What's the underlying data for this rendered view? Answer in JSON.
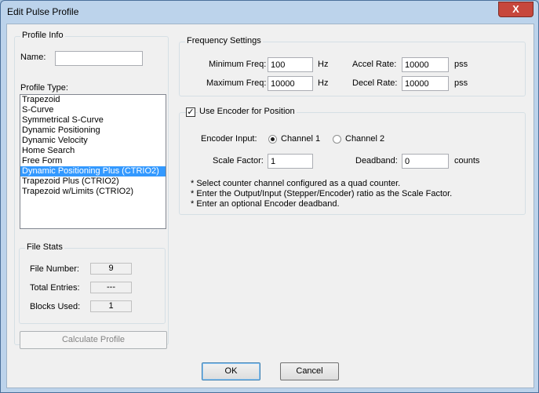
{
  "window": {
    "title": "Edit Pulse Profile",
    "close_glyph": "X"
  },
  "profile_info": {
    "legend": "Profile Info",
    "name_label": "Name:",
    "name_value": "",
    "type_label": "Profile Type:",
    "types": [
      "Trapezoid",
      "S-Curve",
      "Symmetrical S-Curve",
      "Dynamic Positioning",
      "Dynamic Velocity",
      "Home Search",
      "Free Form",
      "Dynamic Positioning Plus (CTRIO2)",
      "Trapezoid Plus (CTRIO2)",
      "Trapezoid w/Limits (CTRIO2)"
    ],
    "selected_index": 7
  },
  "file_stats": {
    "legend": "File Stats",
    "file_number_label": "File Number:",
    "file_number": "9",
    "total_entries_label": "Total Entries:",
    "total_entries": "---",
    "blocks_used_label": "Blocks Used:",
    "blocks_used": "1"
  },
  "calculate_button": "Calculate Profile",
  "frequency": {
    "legend": "Frequency Settings",
    "min_label": "Minimum Freq:",
    "min_value": "100",
    "min_unit": "Hz",
    "max_label": "Maximum Freq:",
    "max_value": "10000",
    "max_unit": "Hz",
    "accel_label": "Accel Rate:",
    "accel_value": "10000",
    "accel_unit": "pss",
    "decel_label": "Decel Rate:",
    "decel_value": "10000",
    "decel_unit": "pss"
  },
  "encoder": {
    "checkbox_label": "Use Encoder for Position",
    "checked": true,
    "input_label": "Encoder Input:",
    "channel1": "Channel 1",
    "channel2": "Channel 2",
    "selected_channel": 1,
    "scale_label": "Scale Factor:",
    "scale_value": "1",
    "deadband_label": "Deadband:",
    "deadband_value": "0",
    "deadband_unit": "counts",
    "notes": [
      "* Select counter channel configured as a quad counter.",
      "* Enter the Output/Input (Stepper/Encoder) ratio as the Scale Factor.",
      "* Enter an optional Encoder deadband."
    ]
  },
  "buttons": {
    "ok": "OK",
    "cancel": "Cancel"
  }
}
